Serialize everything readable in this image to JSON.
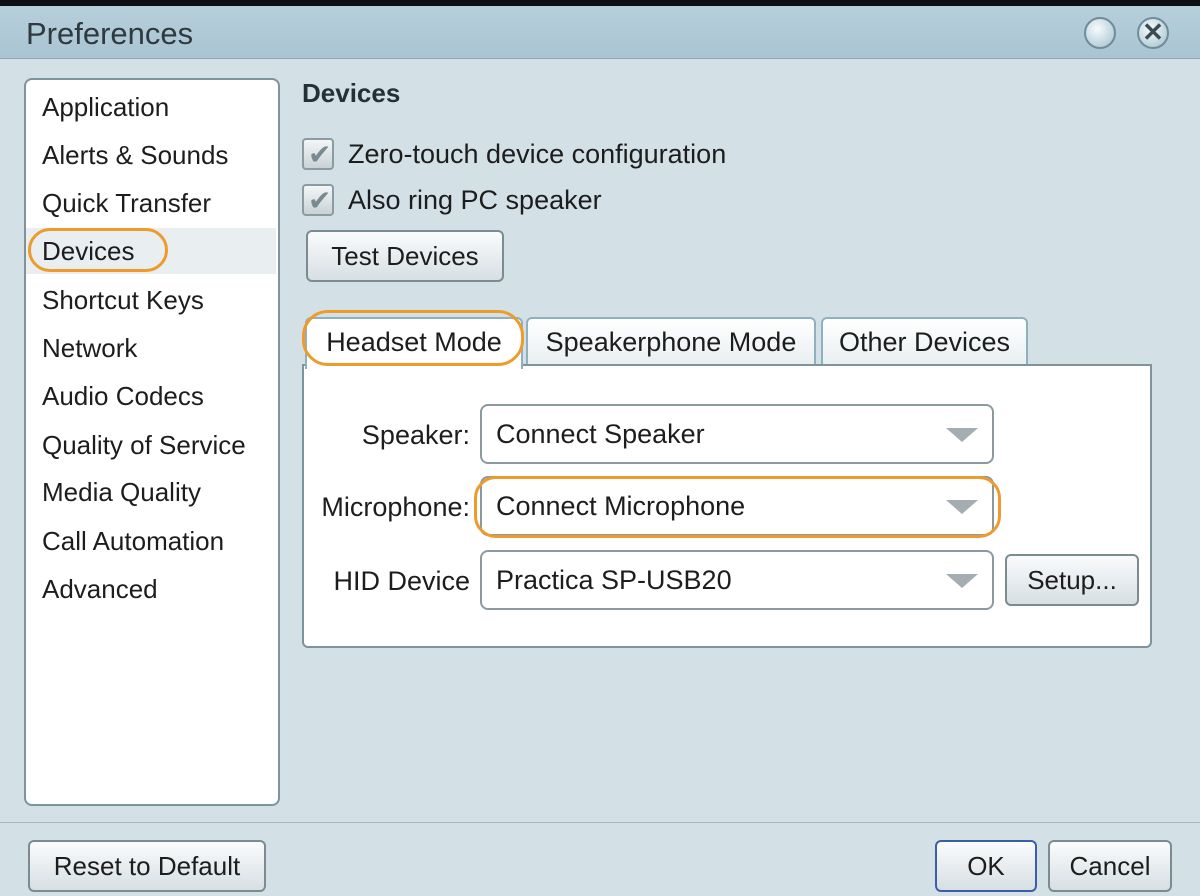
{
  "window": {
    "title": "Preferences",
    "minimize_icon": "minimize-icon",
    "close_icon": "close-icon",
    "close_glyph": "✕"
  },
  "sidebar": {
    "selected": "Devices",
    "items": [
      {
        "label": "Application"
      },
      {
        "label": "Alerts & Sounds"
      },
      {
        "label": "Quick Transfer"
      },
      {
        "label": "Devices"
      },
      {
        "label": "Shortcut Keys"
      },
      {
        "label": "Network"
      },
      {
        "label": "Audio Codecs"
      },
      {
        "label": "Quality of Service"
      },
      {
        "label": "Media Quality"
      },
      {
        "label": "Call Automation"
      },
      {
        "label": "Advanced"
      }
    ]
  },
  "main": {
    "section_title": "Devices",
    "checkboxes": [
      {
        "label": "Zero-touch device configuration",
        "checked": true
      },
      {
        "label": "Also ring PC speaker",
        "checked": true
      }
    ],
    "check_glyph": "✔",
    "test_devices_label": "Test Devices",
    "tabs": [
      {
        "label": "Headset Mode",
        "active": true
      },
      {
        "label": "Speakerphone Mode",
        "active": false
      },
      {
        "label": "Other Devices",
        "active": false
      }
    ],
    "fields": {
      "speaker": {
        "label": "Speaker:",
        "value": "Connect Speaker"
      },
      "microphone": {
        "label": "Microphone:",
        "value": "Connect Microphone"
      },
      "hid": {
        "label": "HID Device",
        "value": "Practica SP-USB20"
      }
    },
    "setup_label": "Setup..."
  },
  "footer": {
    "reset_label": "Reset to Default",
    "ok_label": "OK",
    "cancel_label": "Cancel"
  },
  "colors": {
    "highlight": "#ee9b2c",
    "window_bg": "#d3e1e7",
    "titlebar_bg": "#a9c4d2",
    "ok_border": "#3a5fa8"
  }
}
